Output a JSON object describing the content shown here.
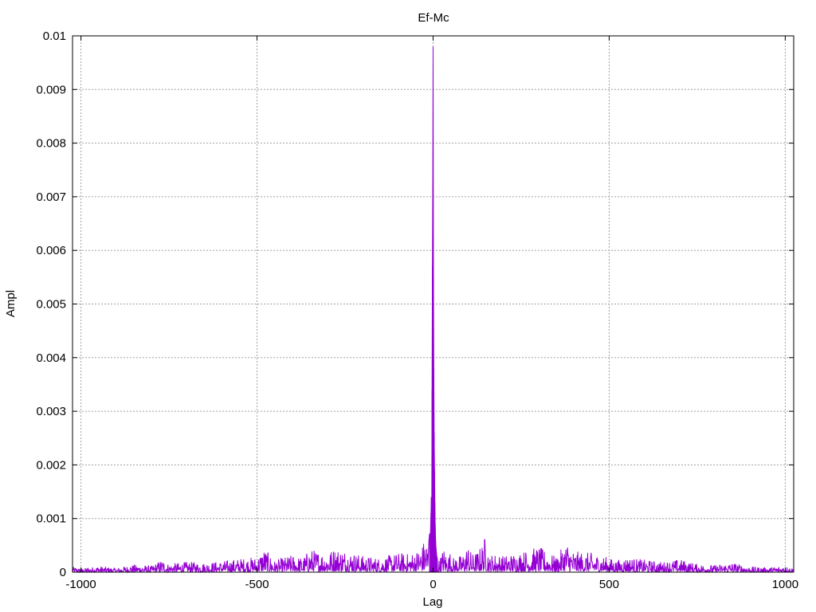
{
  "chart_data": {
    "type": "line",
    "title": "Ef-Mc",
    "xlabel": "Lag",
    "ylabel": "Ampl",
    "xlim": [
      -1024,
      1024
    ],
    "ylim": [
      0,
      0.01
    ],
    "grid": true,
    "legend": "none",
    "line_color": "#9400d3",
    "grid_color": "#a0a0a0",
    "x_ticks": [
      {
        "value": -1000,
        "label": "-1000"
      },
      {
        "value": -500,
        "label": "-500"
      },
      {
        "value": 0,
        "label": "0"
      },
      {
        "value": 500,
        "label": "500"
      },
      {
        "value": 1000,
        "label": "1000"
      }
    ],
    "y_ticks": [
      {
        "value": 0,
        "label": "0"
      },
      {
        "value": 0.001,
        "label": "0.001"
      },
      {
        "value": 0.002,
        "label": "0.002"
      },
      {
        "value": 0.003,
        "label": "0.003"
      },
      {
        "value": 0.004,
        "label": "0.004"
      },
      {
        "value": 0.005,
        "label": "0.005"
      },
      {
        "value": 0.006,
        "label": "0.006"
      },
      {
        "value": 0.007,
        "label": "0.007"
      },
      {
        "value": 0.008,
        "label": "0.008"
      },
      {
        "value": 0.009,
        "label": "0.009"
      },
      {
        "value": 0.01,
        "label": "0.01"
      }
    ],
    "series": [
      {
        "x": [
          -1024,
          -1000,
          -950,
          -900,
          -850,
          -800,
          -770,
          -750,
          -700,
          -650,
          -600,
          -550,
          -500,
          -480,
          -450,
          -400,
          -370,
          -350,
          -300,
          -280,
          -250,
          -200,
          -150,
          -100,
          -70,
          -50,
          -30,
          -20,
          -15,
          -10,
          -8,
          -6,
          -5,
          -4,
          -3,
          -2,
          -1,
          0,
          1,
          2,
          3,
          4,
          5,
          6,
          7,
          8,
          10,
          12,
          15,
          20,
          25,
          30,
          40,
          50,
          60,
          70,
          80,
          90,
          100,
          110,
          130,
          150,
          160,
          170,
          200,
          250,
          300,
          350,
          380,
          400,
          450,
          500,
          520,
          550,
          600,
          650,
          700,
          750,
          800,
          850,
          900,
          950,
          1000,
          1024
        ],
        "y": [
          8e-05,
          5e-05,
          9e-05,
          6e-05,
          0.00011,
          9e-05,
          0.00019,
          0.00012,
          0.00015,
          0.00014,
          0.00016,
          0.0002,
          0.00022,
          0.00035,
          0.00017,
          0.00025,
          0.00021,
          0.00034,
          0.00028,
          0.00036,
          0.00033,
          0.00024,
          0.00021,
          0.00028,
          0.00027,
          0.0003,
          0.00041,
          0.00055,
          0.00038,
          0.00072,
          0.00062,
          0.0011,
          0.0014,
          0.00075,
          0.0034,
          0.0057,
          0.0072,
          0.0098,
          0.0055,
          0.0038,
          0.0026,
          0.0019,
          0.0013,
          0.00088,
          0.00062,
          0.00048,
          0.00032,
          0.00025,
          0.00018,
          0.00022,
          0.00029,
          0.00037,
          0.00024,
          0.00031,
          0.00019,
          0.00028,
          0.00022,
          0.00033,
          0.00041,
          0.00026,
          0.00032,
          0.00055,
          0.00021,
          0.00028,
          0.00024,
          0.0003,
          0.00037,
          0.00022,
          0.00046,
          0.0003,
          0.00028,
          0.00021,
          0.00017,
          0.00022,
          0.00018,
          0.00015,
          0.00019,
          0.00012,
          0.0001,
          0.00014,
          8e-05,
          7e-05,
          9e-05,
          6e-05
        ]
      }
    ]
  }
}
